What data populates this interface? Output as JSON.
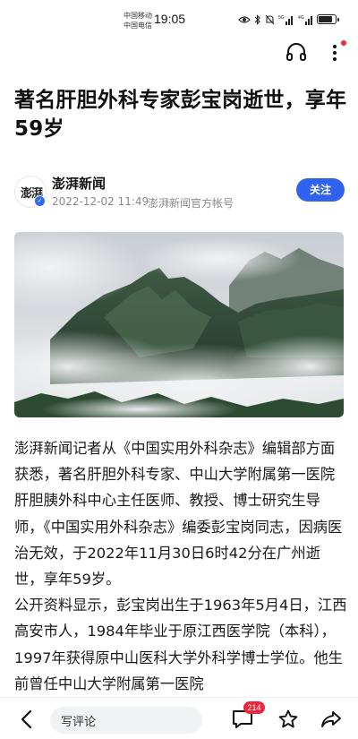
{
  "status_bar": {
    "carrier_1": "中国移动",
    "carrier_2": "中国电信",
    "time": "19:05",
    "signal_1_label": "5G",
    "signal_2_label": "4G",
    "battery_level": 0.82
  },
  "toolbar": {
    "listen_icon": "headphones-icon",
    "more_icon": "more-vertical-icon",
    "has_notification": true
  },
  "article": {
    "title": "著名肝胆外科专家彭宝岗逝世，享年59岁",
    "author": {
      "avatar_text": "澎湃",
      "name": "澎湃新闻",
      "time": "2022-12-02 11:49",
      "account_type": "澎湃新闻官方帐号",
      "follow_label": "关注"
    },
    "paragraphs": [
      "澎湃新闻记者从《中国实用外科杂志》编辑部方面获悉，著名肝胆外科专家、中山大学附属第一医院肝胆胰外科中心主任医师、教授、博士研究生导师，《中国实用外科杂志》编委彭宝岗同志，因病医治无效，于2022年11月30日6时42分在广州逝世，享年59岁。",
      "公开资料显示，彭宝岗出生于1963年5月4日，江西高安市人，1984年毕业于原江西医学院（本科），1997年获得原中山医科大学外科学博士学位。他生前曾任中山大学附属第一医院"
    ]
  },
  "bottom_bar": {
    "comment_placeholder": "写评论",
    "comment_count": "214"
  },
  "colors": {
    "accent": "#2f62f1",
    "badge": "#f0243a",
    "muted_text": "#8a8a8a"
  }
}
